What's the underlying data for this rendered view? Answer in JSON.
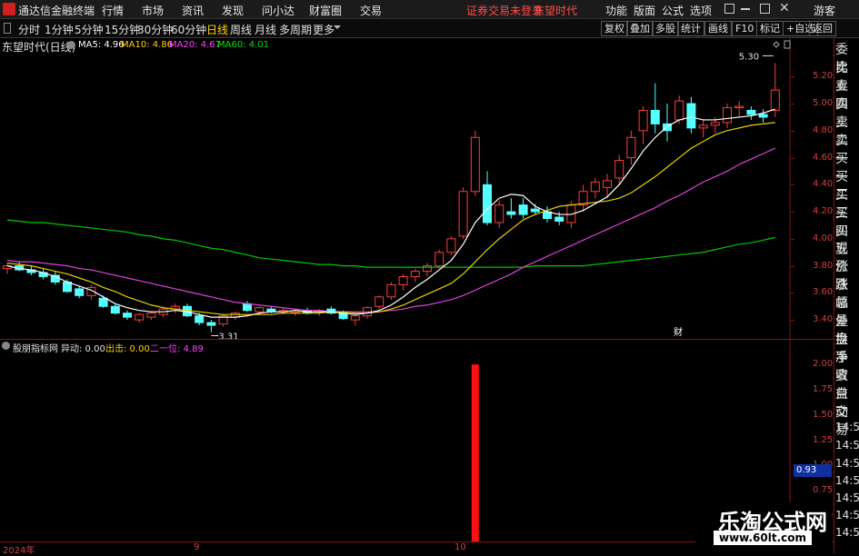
{
  "app": {
    "title": "通达信金融终端",
    "menus": [
      "行情",
      "市场",
      "资讯",
      "发现",
      "问小达",
      "财富圈",
      "交易"
    ],
    "notice": "证券交易未登录",
    "stock_name_header": "东望时代",
    "right_menus": [
      "功能",
      "版面",
      "公式",
      "选项"
    ],
    "user": "游客"
  },
  "toolbar": {
    "periods": [
      "分时",
      "1分钟",
      "5分钟",
      "15分钟",
      "30分钟",
      "60分钟",
      "日线",
      "周线",
      "月线",
      "多周期",
      "更多"
    ],
    "active_period": "日线",
    "right_buttons": [
      "复权",
      "叠加",
      "多股",
      "统计",
      "画线",
      "F10",
      "标记",
      "+自选",
      "返回"
    ]
  },
  "main_chart": {
    "title": "东望时代(日线)",
    "ma_labels": [
      {
        "text": "MA5: 4.96",
        "color": "#ffffff"
      },
      {
        "text": "MA10: 4.86",
        "color": "#ffd400"
      },
      {
        "text": "MA20: 4.67",
        "color": "#ff40ff"
      },
      {
        "text": "MA60: 4.01",
        "color": "#00e000"
      }
    ],
    "high_label": "5.30",
    "low_label": "3.31",
    "finance_marker": "财",
    "y_ticks": [
      "5.20",
      "5.00",
      "4.80",
      "4.60",
      "4.40",
      "4.20",
      "4.00",
      "3.80",
      "3.60",
      "3.40"
    ]
  },
  "indicator": {
    "title": "股朋指标网",
    "labels": [
      {
        "text": "异动: 0.00",
        "color": "#e0e0e0"
      },
      {
        "text": "出击: 0.00",
        "color": "#ffd400"
      },
      {
        "text": "二一位: 4.89",
        "color": "#ff40ff"
      }
    ],
    "y_ticks": [
      "2.00",
      "1.75",
      "1.50",
      "1.25",
      "1.00",
      "0.75",
      "0.50"
    ],
    "current_value": "0.93"
  },
  "x_axis": [
    "2024年",
    "9",
    "10"
  ],
  "right_panel": [
    "委比",
    "卖五",
    "卖四",
    "卖三",
    "卖二",
    "卖一",
    "买一",
    "买二",
    "买三",
    "买四",
    "买五",
    "现价",
    "涨跌",
    "涨幅",
    "总量",
    "外盘",
    "换手",
    "净资",
    "收益",
    "自动",
    "交易",
    "14:55",
    "14:56",
    "14:56",
    "14:56",
    "14:56",
    "14:56",
    "14:56"
  ],
  "watermark": {
    "line1": "乐淘公式网",
    "line2": "www.60lt.com"
  },
  "chart_data": {
    "type": "candlestick",
    "ylim": [
      3.3,
      5.3
    ],
    "ohlc": [
      [
        3.78,
        3.82,
        3.74,
        3.8
      ],
      [
        3.8,
        3.83,
        3.76,
        3.77
      ],
      [
        3.77,
        3.8,
        3.73,
        3.75
      ],
      [
        3.75,
        3.78,
        3.7,
        3.72
      ],
      [
        3.73,
        3.76,
        3.66,
        3.68
      ],
      [
        3.68,
        3.7,
        3.6,
        3.61
      ],
      [
        3.63,
        3.65,
        3.56,
        3.58
      ],
      [
        3.58,
        3.66,
        3.55,
        3.64
      ],
      [
        3.56,
        3.58,
        3.49,
        3.5
      ],
      [
        3.5,
        3.52,
        3.44,
        3.45
      ],
      [
        3.45,
        3.47,
        3.4,
        3.42
      ],
      [
        3.4,
        3.45,
        3.38,
        3.44
      ],
      [
        3.42,
        3.46,
        3.4,
        3.45
      ],
      [
        3.44,
        3.5,
        3.42,
        3.48
      ],
      [
        3.48,
        3.52,
        3.45,
        3.5
      ],
      [
        3.5,
        3.52,
        3.42,
        3.43
      ],
      [
        3.43,
        3.45,
        3.36,
        3.38
      ],
      [
        3.38,
        3.4,
        3.31,
        3.36
      ],
      [
        3.37,
        3.44,
        3.35,
        3.43
      ],
      [
        3.42,
        3.46,
        3.4,
        3.45
      ],
      [
        3.52,
        3.54,
        3.46,
        3.47
      ],
      [
        3.46,
        3.5,
        3.44,
        3.49
      ],
      [
        3.48,
        3.5,
        3.45,
        3.46
      ],
      [
        3.46,
        3.49,
        3.44,
        3.47
      ],
      [
        3.45,
        3.48,
        3.43,
        3.46
      ],
      [
        3.47,
        3.49,
        3.44,
        3.45
      ],
      [
        3.46,
        3.48,
        3.43,
        3.47
      ],
      [
        3.48,
        3.5,
        3.44,
        3.45
      ],
      [
        3.45,
        3.47,
        3.4,
        3.41
      ],
      [
        3.4,
        3.44,
        3.36,
        3.43
      ],
      [
        3.43,
        3.5,
        3.41,
        3.49
      ],
      [
        3.5,
        3.58,
        3.48,
        3.57
      ],
      [
        3.57,
        3.68,
        3.55,
        3.66
      ],
      [
        3.66,
        3.74,
        3.62,
        3.72
      ],
      [
        3.72,
        3.78,
        3.68,
        3.76
      ],
      [
        3.76,
        3.82,
        3.72,
        3.8
      ],
      [
        3.8,
        3.92,
        3.78,
        3.9
      ],
      [
        3.9,
        4.02,
        3.88,
        4.0
      ],
      [
        4.02,
        4.38,
        4.0,
        4.35
      ],
      [
        4.35,
        4.8,
        4.32,
        4.75
      ],
      [
        4.4,
        4.5,
        4.1,
        4.12
      ],
      [
        4.12,
        4.28,
        4.08,
        4.25
      ],
      [
        4.2,
        4.3,
        4.15,
        4.18
      ],
      [
        4.25,
        4.3,
        4.15,
        4.18
      ],
      [
        4.22,
        4.26,
        4.18,
        4.2
      ],
      [
        4.2,
        4.24,
        4.12,
        4.15
      ],
      [
        4.16,
        4.2,
        4.1,
        4.13
      ],
      [
        4.12,
        4.28,
        4.08,
        4.25
      ],
      [
        4.25,
        4.4,
        4.2,
        4.35
      ],
      [
        4.35,
        4.45,
        4.3,
        4.42
      ],
      [
        4.38,
        4.48,
        4.3,
        4.43
      ],
      [
        4.45,
        4.62,
        4.4,
        4.58
      ],
      [
        4.6,
        4.8,
        4.55,
        4.75
      ],
      [
        4.8,
        4.98,
        4.7,
        4.95
      ],
      [
        4.95,
        5.15,
        4.78,
        4.85
      ],
      [
        4.85,
        5.0,
        4.72,
        4.8
      ],
      [
        4.88,
        5.06,
        4.85,
        5.02
      ],
      [
        5.0,
        5.05,
        4.78,
        4.82
      ],
      [
        4.82,
        4.88,
        4.75,
        4.84
      ],
      [
        4.84,
        4.9,
        4.78,
        4.86
      ],
      [
        4.86,
        5.0,
        4.82,
        4.97
      ],
      [
        4.97,
        5.02,
        4.9,
        4.98
      ],
      [
        4.95,
        4.98,
        4.88,
        4.92
      ],
      [
        4.92,
        4.96,
        4.86,
        4.9
      ],
      [
        4.95,
        5.3,
        4.9,
        5.1
      ]
    ],
    "ma5": [
      3.8,
      3.78,
      3.77,
      3.75,
      3.72,
      3.68,
      3.65,
      3.62,
      3.57,
      3.52,
      3.49,
      3.47,
      3.46,
      3.46,
      3.47,
      3.46,
      3.44,
      3.42,
      3.42,
      3.42,
      3.43,
      3.45,
      3.46,
      3.46,
      3.47,
      3.46,
      3.46,
      3.46,
      3.45,
      3.44,
      3.45,
      3.47,
      3.51,
      3.57,
      3.64,
      3.7,
      3.77,
      3.84,
      3.96,
      4.12,
      4.22,
      4.3,
      4.33,
      4.32,
      4.24,
      4.2,
      4.18,
      4.18,
      4.21,
      4.26,
      4.31,
      4.4,
      4.52,
      4.65,
      4.75,
      4.83,
      4.88,
      4.9,
      4.88,
      4.88,
      4.89,
      4.9,
      4.91,
      4.93,
      4.96
    ],
    "ma10": [
      3.82,
      3.81,
      3.8,
      3.78,
      3.76,
      3.74,
      3.71,
      3.68,
      3.64,
      3.61,
      3.57,
      3.54,
      3.51,
      3.49,
      3.48,
      3.47,
      3.46,
      3.45,
      3.44,
      3.44,
      3.44,
      3.44,
      3.44,
      3.45,
      3.45,
      3.45,
      3.45,
      3.46,
      3.46,
      3.45,
      3.45,
      3.46,
      3.48,
      3.51,
      3.55,
      3.59,
      3.63,
      3.67,
      3.74,
      3.83,
      3.92,
      4.0,
      4.07,
      4.14,
      4.18,
      4.21,
      4.24,
      4.25,
      4.26,
      4.27,
      4.28,
      4.3,
      4.34,
      4.4,
      4.46,
      4.53,
      4.6,
      4.67,
      4.72,
      4.77,
      4.8,
      4.82,
      4.84,
      4.85,
      4.86
    ],
    "ma20": [
      3.84,
      3.83,
      3.83,
      3.82,
      3.81,
      3.8,
      3.78,
      3.77,
      3.75,
      3.73,
      3.71,
      3.69,
      3.67,
      3.65,
      3.63,
      3.61,
      3.59,
      3.57,
      3.55,
      3.53,
      3.52,
      3.51,
      3.5,
      3.49,
      3.48,
      3.47,
      3.47,
      3.46,
      3.46,
      3.46,
      3.46,
      3.46,
      3.47,
      3.48,
      3.5,
      3.51,
      3.53,
      3.55,
      3.58,
      3.62,
      3.66,
      3.7,
      3.74,
      3.79,
      3.83,
      3.87,
      3.91,
      3.95,
      3.99,
      4.03,
      4.07,
      4.11,
      4.15,
      4.19,
      4.23,
      4.28,
      4.32,
      4.37,
      4.42,
      4.46,
      4.5,
      4.55,
      4.59,
      4.63,
      4.67
    ],
    "ma60": [
      4.14,
      4.13,
      4.12,
      4.12,
      4.11,
      4.1,
      4.09,
      4.08,
      4.07,
      4.06,
      4.05,
      4.03,
      4.02,
      4.0,
      3.99,
      3.97,
      3.95,
      3.93,
      3.92,
      3.9,
      3.88,
      3.86,
      3.85,
      3.84,
      3.83,
      3.82,
      3.81,
      3.81,
      3.8,
      3.8,
      3.79,
      3.79,
      3.79,
      3.79,
      3.79,
      3.79,
      3.79,
      3.79,
      3.79,
      3.79,
      3.79,
      3.79,
      3.79,
      3.79,
      3.8,
      3.8,
      3.8,
      3.8,
      3.8,
      3.81,
      3.82,
      3.83,
      3.84,
      3.85,
      3.86,
      3.87,
      3.88,
      3.89,
      3.9,
      3.92,
      3.94,
      3.96,
      3.97,
      3.99,
      4.01
    ],
    "indicator_bars": [
      {
        "index": 39,
        "value": 2.0
      }
    ]
  }
}
